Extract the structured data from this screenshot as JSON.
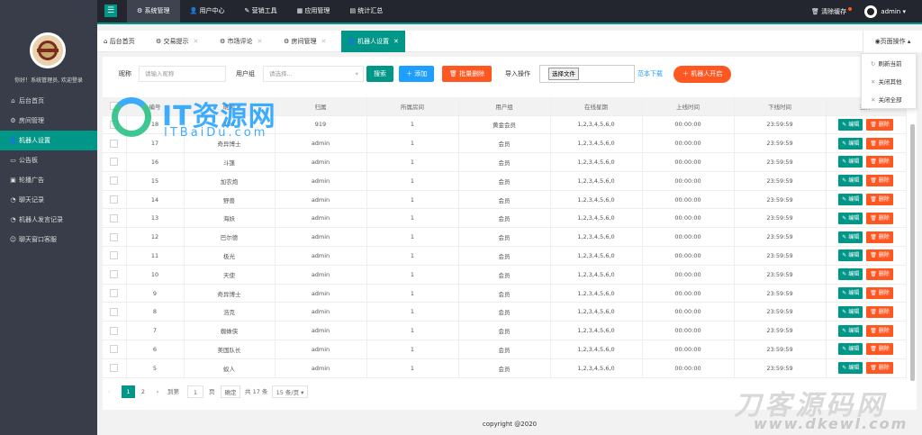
{
  "sidebar": {
    "welcome": "你好！系统管理员, 欢迎登录",
    "items": [
      {
        "icon": "⌂",
        "label": "后台首页"
      },
      {
        "icon": "⚙",
        "label": "房间管理"
      },
      {
        "icon": "👤",
        "label": "机器人设置"
      },
      {
        "icon": "▭",
        "label": "公告板"
      },
      {
        "icon": "▣",
        "label": "轮播广告"
      },
      {
        "icon": "◔",
        "label": "聊天记录"
      },
      {
        "icon": "◔",
        "label": "机器人发言记录"
      },
      {
        "icon": "☺",
        "label": "聊天窗口客服"
      }
    ]
  },
  "header": {
    "nav": [
      "系统管理",
      "用户中心",
      "营销工具",
      "应用管理",
      "统计汇总"
    ],
    "nav_icons": [
      "⚙",
      "👤",
      "✎",
      "▦",
      "▤"
    ],
    "clear_cache": "清除缓存",
    "user": "admin"
  },
  "tabs": {
    "items": [
      "后台首页",
      "交易提示",
      "市场评论",
      "房间管理",
      "机器人设置"
    ],
    "page_ops": "页面操作"
  },
  "dropdown": {
    "items": [
      "刷新当前",
      "关闭其他",
      "关闭全部"
    ]
  },
  "search": {
    "nickname_label": "昵称",
    "nickname_placeholder": "请输入昵称",
    "group_label": "用户组",
    "group_placeholder": "请选择...",
    "search_btn": "搜索",
    "add_btn": "添加",
    "batch_delete_btn": "批量删除",
    "import_label": "导入操作",
    "choose_file": "选择文件",
    "template_download": "范本下载",
    "robot_start": "机器人开启"
  },
  "table": {
    "headers": [
      "",
      "编号",
      "昵称",
      "归属",
      "所属房间",
      "用户组",
      "在线星期",
      "上线时间",
      "下线时间",
      "操作"
    ],
    "edit_label": "编辑",
    "delete_label": "删除",
    "rows": [
      [
        "18",
        "123",
        "919",
        "1",
        "黄金会员",
        "1,2,3,4,5,6,0",
        "00:00:00",
        "23:59:59"
      ],
      [
        "17",
        "奇异博士",
        "admin",
        "1",
        "会员",
        "1,2,3,4,5,6,0",
        "00:00:00",
        "23:59:59"
      ],
      [
        "16",
        "斗篷",
        "admin",
        "1",
        "会员",
        "1,2,3,4,5,6,0",
        "00:00:00",
        "23:59:59"
      ],
      [
        "15",
        "加农炮",
        "admin",
        "1",
        "会员",
        "1,2,3,4,5,6,0",
        "00:00:00",
        "23:59:59"
      ],
      [
        "14",
        "野兽",
        "admin",
        "1",
        "会员",
        "1,2,3,4,5,6,0",
        "00:00:00",
        "23:59:59"
      ],
      [
        "13",
        "海妖",
        "admin",
        "1",
        "会员",
        "1,2,3,4,5,6,0",
        "00:00:00",
        "23:59:59"
      ],
      [
        "12",
        "巴尔德",
        "admin",
        "1",
        "会员",
        "1,2,3,4,5,6,0",
        "00:00:00",
        "23:59:59"
      ],
      [
        "11",
        "极光",
        "admin",
        "1",
        "会员",
        "1,2,3,4,5,6,0",
        "00:00:00",
        "23:59:59"
      ],
      [
        "10",
        "天使",
        "admin",
        "1",
        "会员",
        "1,2,3,4,5,6,0",
        "00:00:00",
        "23:59:59"
      ],
      [
        "9",
        "奇异博士",
        "admin",
        "1",
        "会员",
        "1,2,3,4,5,6,0",
        "00:00:00",
        "23:59:59"
      ],
      [
        "8",
        "浩克",
        "admin",
        "1",
        "会员",
        "1,2,3,4,5,6,0",
        "00:00:00",
        "23:59:59"
      ],
      [
        "7",
        "蜘蛛侠",
        "admin",
        "1",
        "会员",
        "1,2,3,4,5,6,0",
        "00:00:00",
        "23:59:59"
      ],
      [
        "6",
        "美国队长",
        "admin",
        "1",
        "会员",
        "1,2,3,4,5,6,0",
        "00:00:00",
        "23:59:59"
      ],
      [
        "5",
        "蚁人",
        "admin",
        "1",
        "会员",
        "1,2,3,4,5,6,0",
        "00:00:00",
        "23:59:59"
      ]
    ]
  },
  "pager": {
    "page1": "1",
    "page2": "2",
    "goto": "到第",
    "page_input": "1",
    "page_unit": "页",
    "confirm": "确定",
    "total": "共 17 条",
    "per_page": "15 条/页"
  },
  "footer": "copyright @2020",
  "watermarks": {
    "top_title": "IT资源网",
    "top_sub": "ITBaiDu.com",
    "bottom_title": "刀客源码网",
    "bottom_sub": "www.dkewl.com"
  },
  "colors": {
    "accent": "#009688",
    "blue": "#1e9fff",
    "orange": "#ff5722",
    "sidebar": "#393d49",
    "header": "#23262e"
  }
}
